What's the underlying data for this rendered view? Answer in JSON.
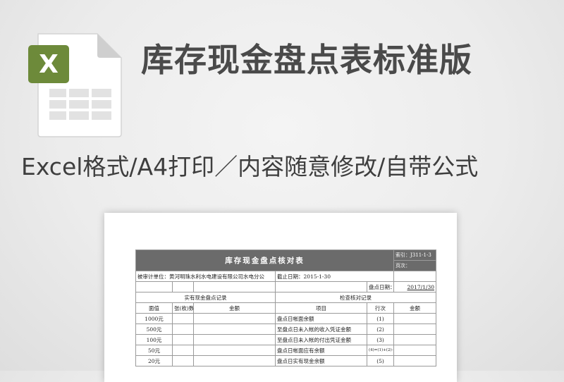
{
  "header": {
    "title": "库存现金盘点表标准版",
    "subtitle": "Excel格式/A4打印／内容随意修改/自带公式",
    "file_icon": "excel-file-icon",
    "file_icon_badge": "X",
    "accent_color": "#6d8a3a"
  },
  "sheet": {
    "title": "库存现金盘点核对表",
    "index_label": "索引：J311-1-3",
    "page_label": "页次：",
    "audited_unit": "被审计单位：黄河明珠水利水电建设有限公司水电分公",
    "cutoff_date": "截止日期：2015-1-30",
    "count_date_label": "盘点日期：",
    "count_date_value": "2017/1/30",
    "left_section": "实有现金盘点记录",
    "right_section": "检查核对记录",
    "col_denomination": "面值",
    "col_count": "张(枚)数",
    "col_amount": "金额",
    "col_item": "项目",
    "col_line": "行次",
    "col_amount2": "金额",
    "rows": [
      {
        "denom": "1000元",
        "item": "盘点日帐面余额",
        "line": "(1)"
      },
      {
        "denom": "500元",
        "item": "至盘点日未入帐的收入凭证金额",
        "line": "(2)"
      },
      {
        "denom": "100元",
        "item": "至盘点日未入帐的付出凭证金额",
        "line": "(3)"
      },
      {
        "denom": "50元",
        "item": "盘点日帐面应有余额",
        "line": "(4)=(1)+(2)-(3)"
      },
      {
        "denom": "20元",
        "item": "盘点日实有现金余额",
        "line": "(5)"
      }
    ]
  }
}
